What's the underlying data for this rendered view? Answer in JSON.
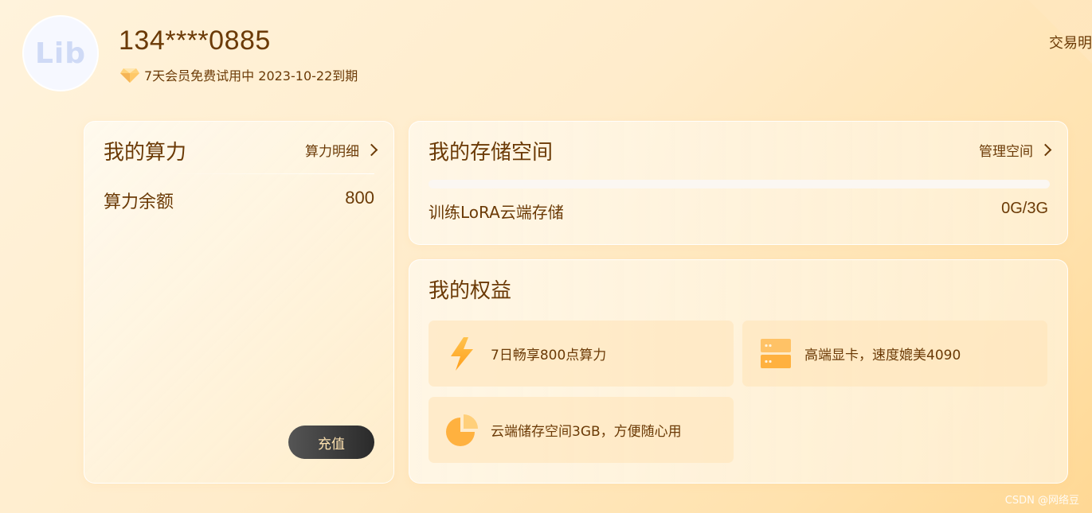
{
  "header": {
    "avatar_text": "Lib",
    "username": "134****0885",
    "membership": "7天会员免费试用中  2023-10-22到期",
    "top_link": "交易明"
  },
  "compute": {
    "title": "我的算力",
    "link": "算力明细",
    "balance_label": "算力余额",
    "balance_value": "800",
    "recharge_label": "充值"
  },
  "storage": {
    "title": "我的存储空间",
    "link": "管理空间",
    "label": "训练LoRA云端存储",
    "value": "0G/3G",
    "used_fraction": 0
  },
  "rights": {
    "title": "我的权益",
    "items": [
      {
        "icon": "lightning-icon",
        "text": "7日畅享800点算力"
      },
      {
        "icon": "server-icon",
        "text": "高端显卡，速度媲美4090"
      },
      {
        "icon": "pie-chart-icon",
        "text": "云端储存空间3GB，方便随心用"
      }
    ]
  },
  "watermark": "CSDN @网络豆",
  "colors": {
    "accent": "#ffb84d",
    "text": "#6b3a06",
    "button_text": "#ffe3b0"
  }
}
